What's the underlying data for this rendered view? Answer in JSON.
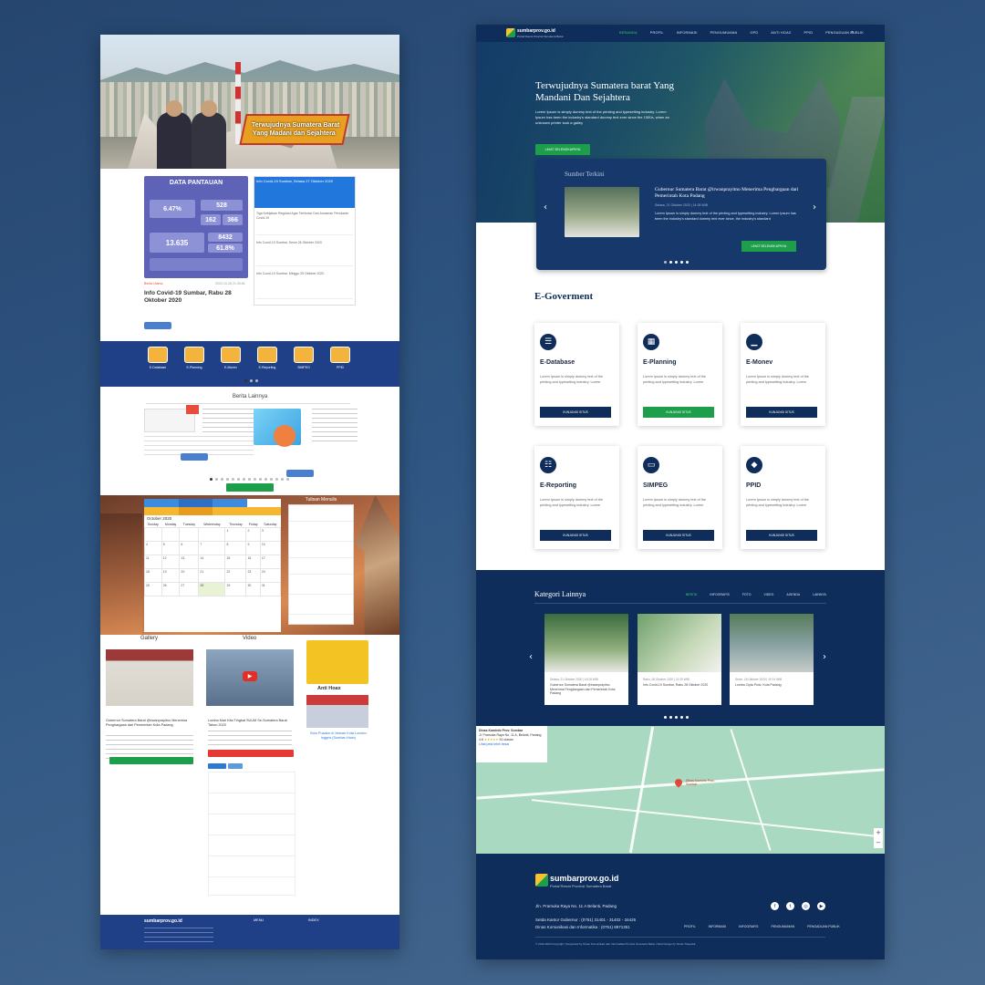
{
  "left": {
    "hero": {
      "banner_line1": "Terwujudnya Sumatera Barat",
      "banner_line2": "Yang Madani dan Sejahtera"
    },
    "data_pantauan": {
      "title": "DATA PANTAUAN",
      "vals": [
        "6.47%",
        "528",
        "162",
        "366",
        "13.635",
        "8432",
        "61.8%"
      ]
    },
    "featured": {
      "title": "Info Covid-19 Sumbar, Rabu 28 Oktober 2020",
      "tag": "Berita Utama",
      "date": "2020-10-28 21:39:46"
    },
    "news": [
      "Info Covid-19 Sumbar, Selasa 27 Oktober 2020",
      "Tiga Kebijakan Regulasi Agar Terhindar Dari Ancaman Penularan Covid-19",
      "Info Covid-19 Sumbar, Senin 26 Oktober 2020",
      "Info Covid-19 Sumbar, Minggu 25 Oktober 2020"
    ],
    "apps": [
      "E-Database",
      "E-Planning",
      "E-Monev",
      "E-Reporting",
      "SIMPEG",
      "PPID"
    ],
    "berita_lainnya": "Berita Lainnya",
    "calendar": {
      "month": "October 2020",
      "days": [
        "Sunday",
        "Monday",
        "Tuesday",
        "Wednesday",
        "Thursday",
        "Friday",
        "Saturday"
      ]
    },
    "tulisan": "Tulisan Menulis",
    "gallery_label": "Gallery",
    "video_label": "Video",
    "anti_hoax": "Anti Hoax",
    "gallery_caption": "Gubernur Sumatera Barat @irwanprayitno Menerima Penghargaan dari Pemerintah Kota Padang",
    "video_caption": "Lomba Mari Kita Tingkat SUUM Se-Sumatera Barat Tahun 2020",
    "hoax_caption": "Bulu Pusaka di Jelaran Kota London Inggris (Sumbar-Hoax)",
    "footer": {
      "logo": "sumbarprov.go.id",
      "col1": "MENU",
      "col2": "INDEX"
    }
  },
  "right": {
    "nav": {
      "logo": "sumbarprov.go.id",
      "logo_sub": "Portal Resmi Provinsi Sumatera Barat",
      "items": [
        "BERANDA",
        "PROFIL",
        "INFORMASI",
        "PENGUMUMAN",
        "OPD",
        "ANTI HOAX",
        "PPID",
        "PENGADUAN PUBLIK"
      ],
      "active_index": 0
    },
    "hero": {
      "title": "Terwujudnya Sumatera barat Yang Mandani Dan Sejahtera",
      "desc": "Lorem Ipsum is simply dummy text of the printing and typesetting industry. Lorem Ipsum has been the industry's standard dummy text ever since the 1500s, when an unknown printer took a galley",
      "cta": "LIHAT SELENGKAPNYA"
    },
    "sumber": {
      "heading": "Sumber Terkini",
      "title": "Gubernur Sumatera Barat @irwanprayitno Menerima Pengbargaan dari Pemerintah Kota Padang",
      "date": "Selasa, 21 Oktober 2020 | 14:28 WIB",
      "desc": "Lorem Ipsum is simply dummy text of the printing and typesetting industry. Lorem Ipsum has been the industry's standard dummy text ever since, the industry's standard",
      "cta": "LIHAT SELENGKAPNYA"
    },
    "egov_title": "E-Goverment",
    "egov": [
      {
        "name": "E-Database",
        "icon": "database-icon",
        "glyph": "☰",
        "desc": "Lorem Ipsum is simply dummy text of the printing and typesetting industry. Lorem",
        "cta": "KUNJUNGI SITUS"
      },
      {
        "name": "E-Planning",
        "icon": "calendar-icon",
        "glyph": "▦",
        "desc": "Lorem Ipsum is simply dummy text of the printing and typesetting industry. Lorem",
        "cta": "KUNJUNGI SITUS"
      },
      {
        "name": "E-Monev",
        "icon": "chart-icon",
        "glyph": "▁",
        "desc": "Lorem Ipsum is simply dummy text of the printing and typesetting industry. Lorem",
        "cta": "KUNJUNGI SITUS"
      },
      {
        "name": "E-Reporting",
        "icon": "document-icon",
        "glyph": "☷",
        "desc": "Lorem Ipsum is simply dummy text of the printing and typesetting industry. Lorem",
        "cta": "KUNJUNGI SITUS"
      },
      {
        "name": "SIMPEG",
        "icon": "laptop-icon",
        "glyph": "▭",
        "desc": "Lorem Ipsum is simply dummy text of the printing and typesetting industry. Lorem",
        "cta": "KUNJUNGI SITUS"
      },
      {
        "name": "PPID",
        "icon": "badge-icon",
        "glyph": "◆",
        "desc": "Lorem Ipsum is simply dummy text of the printing and typesetting industry. Lorem",
        "cta": "KUNJUNGI SITUS"
      }
    ],
    "kategori": {
      "title": "Kategori Lainnya",
      "tabs": [
        "BERITA",
        "INFOGRAFIS",
        "FOTO",
        "VIDEO",
        "AGENDA",
        "LAINNYA"
      ],
      "cards": [
        {
          "date": "Selasa, 21 Oktober 2020 | 14:28 WIB",
          "title": "Gubernur Sumatera Barat @irwanprayitno Menerima Pengbargaan dari Pemerintah Kota Padang"
        },
        {
          "date": "Rabu, 28 Oktober 2020 | 21:39 WIB",
          "title": "Info Covid-19 Sumbar, Rabu 28 Oktober 2020"
        },
        {
          "date": "Senin, 26 Oktober 2020 | 10:14 WIB",
          "title": "Lomba Cipta Puisi, Kota Padang"
        }
      ]
    },
    "map": {
      "place": "Dinas Kominfo Prov. Sumbar",
      "address": "Jl. Pramuka Raya No. 11 A, Belanti, Padang",
      "rating": "4.6",
      "reviews": "51 ulasan",
      "link": "Lihat peta lebih besar",
      "pin_label": "Dinas Kominfo Prov. Sumbar"
    },
    "footer": {
      "logo": "sumbarprov.go.id",
      "logo_sub": "Portal Resmi Provinsi Sumatera Barat",
      "address": "Jln. Pramuka Raya No. 11 A Belanti, Padang",
      "phone1": "Setda Kantor Gubernur : (0751) 31401 - 31402 - 34425",
      "phone2": "Dinas Komunikasi dan Informatika : (0751) 8971351",
      "links": [
        "PROFIL",
        "INFORMASI",
        "INFOGRAFIS",
        "PENGUMUMAN",
        "PENGADUAN PUBLIK"
      ],
      "copyright": "© 2019-2020 Copyright | Supported by Dinas Komunikasi dan Informatika Provinsi Sumatera Barat | Web Design by Sindu Triayuddi"
    },
    "colors": {
      "navy": "#0f2d5a",
      "green": "#1d9e4b",
      "active": "#3dcc6a"
    }
  }
}
